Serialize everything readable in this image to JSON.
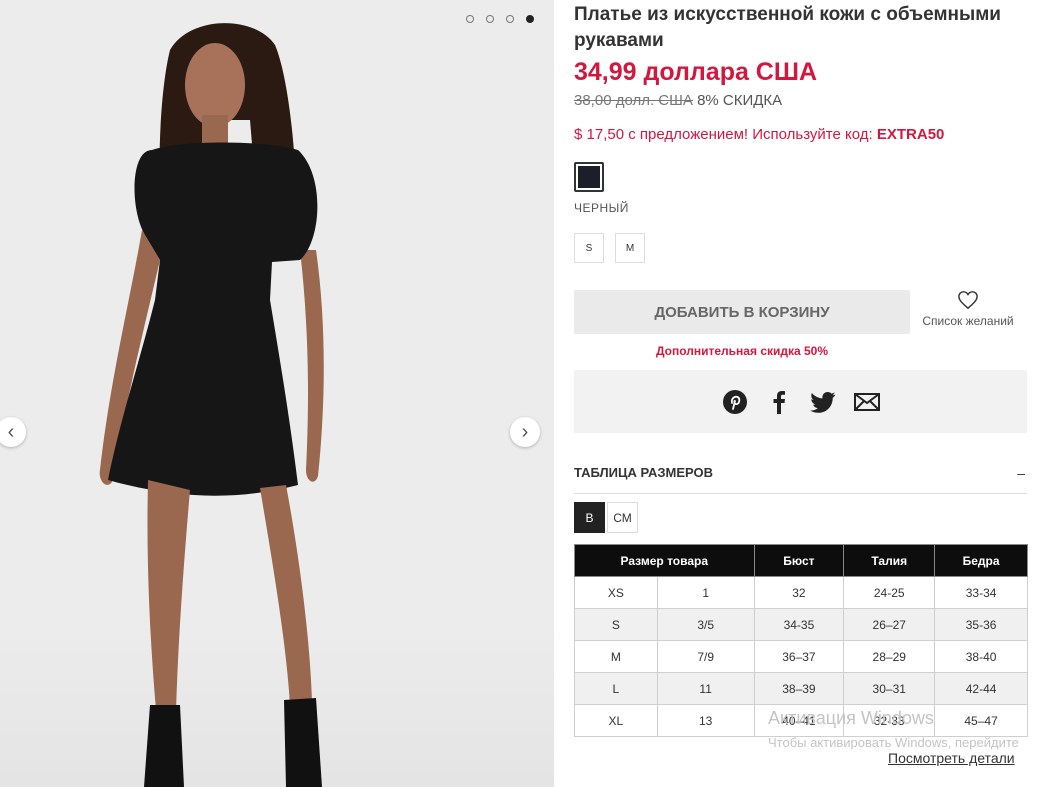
{
  "gallery": {
    "slide_count": 4,
    "active_slide": 4,
    "prev_label": "‹",
    "next_label": "›"
  },
  "product": {
    "title": "Платье из искусственной кожи с объемными рукавами",
    "price": "34,99 доллара США",
    "old_price": "38,00 долл. США",
    "discount_pct": "8% СКИДКА",
    "promo_text": "$ 17,50 с предложением! Используйте код: ",
    "promo_code": "EXTRA50",
    "color_name": "ЧЕРНЫЙ",
    "sizes": [
      "S",
      "M"
    ],
    "add_to_cart": "ДОБАВИТЬ В КОРЗИНУ",
    "wishlist": "Список желаний",
    "extra_discount": "Дополнительная скидка 50%"
  },
  "size_chart": {
    "title": "ТАБЛИЦА РАЗМЕРОВ",
    "collapse": "–",
    "units": [
      "В",
      "СМ"
    ],
    "headers": [
      "Размер товара",
      "Бюст",
      "Талия",
      "Бедра"
    ],
    "rows": [
      [
        "XS",
        "1",
        "32",
        "24-25",
        "33-34"
      ],
      [
        "S",
        "3/5",
        "34-35",
        "26–27",
        "35-36"
      ],
      [
        "M",
        "7/9",
        "36–37",
        "28–29",
        "38-40"
      ],
      [
        "L",
        "11",
        "38–39",
        "30–31",
        "42-44"
      ],
      [
        "XL",
        "13",
        "40–41",
        "32-33",
        "45–47"
      ]
    ],
    "details_link": "Посмотреть детали"
  },
  "watermark": {
    "line1": "Активация Windows",
    "line2": "Чтобы активировать Windows, перейдите"
  },
  "colors": {
    "accent": "#d3173f",
    "swatch": "#1c1f2a"
  }
}
